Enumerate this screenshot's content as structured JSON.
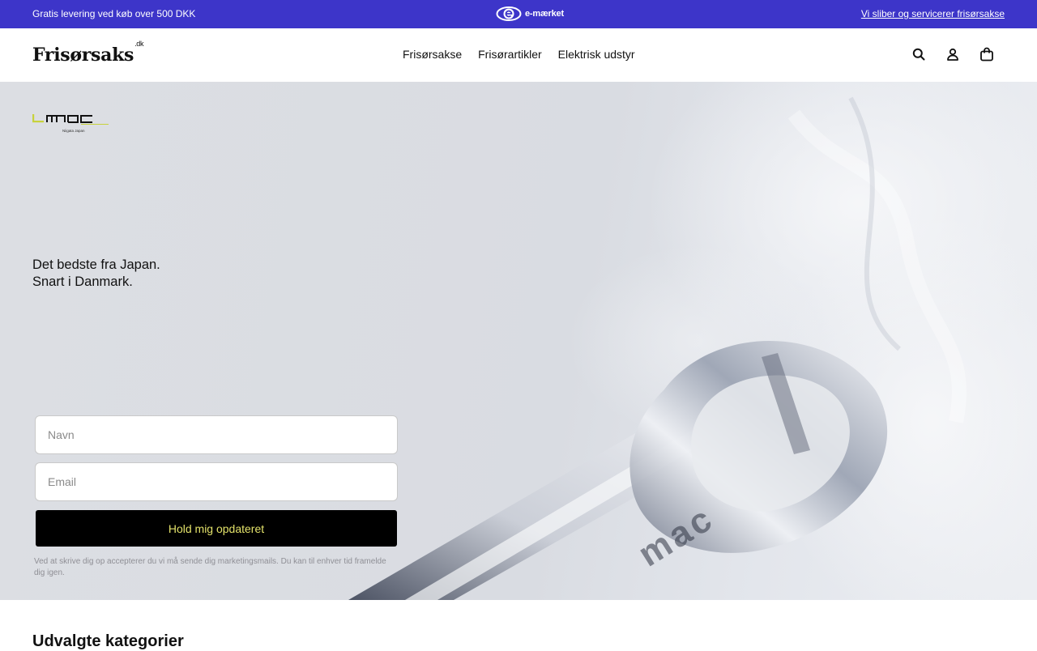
{
  "announcement": {
    "left_text": "Gratis levering ved køb over 500 DKK",
    "badge_text": "e-mærket",
    "right_link": "Vi sliber og servicerer frisørsakse"
  },
  "header": {
    "logo_text": "Frisørsaks",
    "logo_suffix": ".dk",
    "nav": [
      "Frisørsakse",
      "Frisørartikler",
      "Elektrisk udstyr"
    ],
    "icons": [
      "search-icon",
      "account-icon",
      "cart-icon"
    ]
  },
  "hero": {
    "brand_logo_text": "mac",
    "brand_logo_sub": "Niigata Japan",
    "headline_line1": "Det bedste fra Japan.",
    "headline_line2": "Snart i Danmark.",
    "form": {
      "name_placeholder": "Navn",
      "name_value": "",
      "email_placeholder": "Email",
      "email_value": "",
      "submit_label": "Hold mig opdateret"
    },
    "disclaimer": "Ved at skrive dig op accepterer du vi må sende dig marketingsmails. Du kan til enhver tid framelde dig igen.",
    "image_engraving": "mac"
  },
  "sections": {
    "featured_title": "Udvalgte kategorier"
  },
  "colors": {
    "announcement_bg": "#3d35c9",
    "button_bg": "#000000",
    "button_text": "#e3e26a",
    "brand_accent": "#c8d23c"
  }
}
